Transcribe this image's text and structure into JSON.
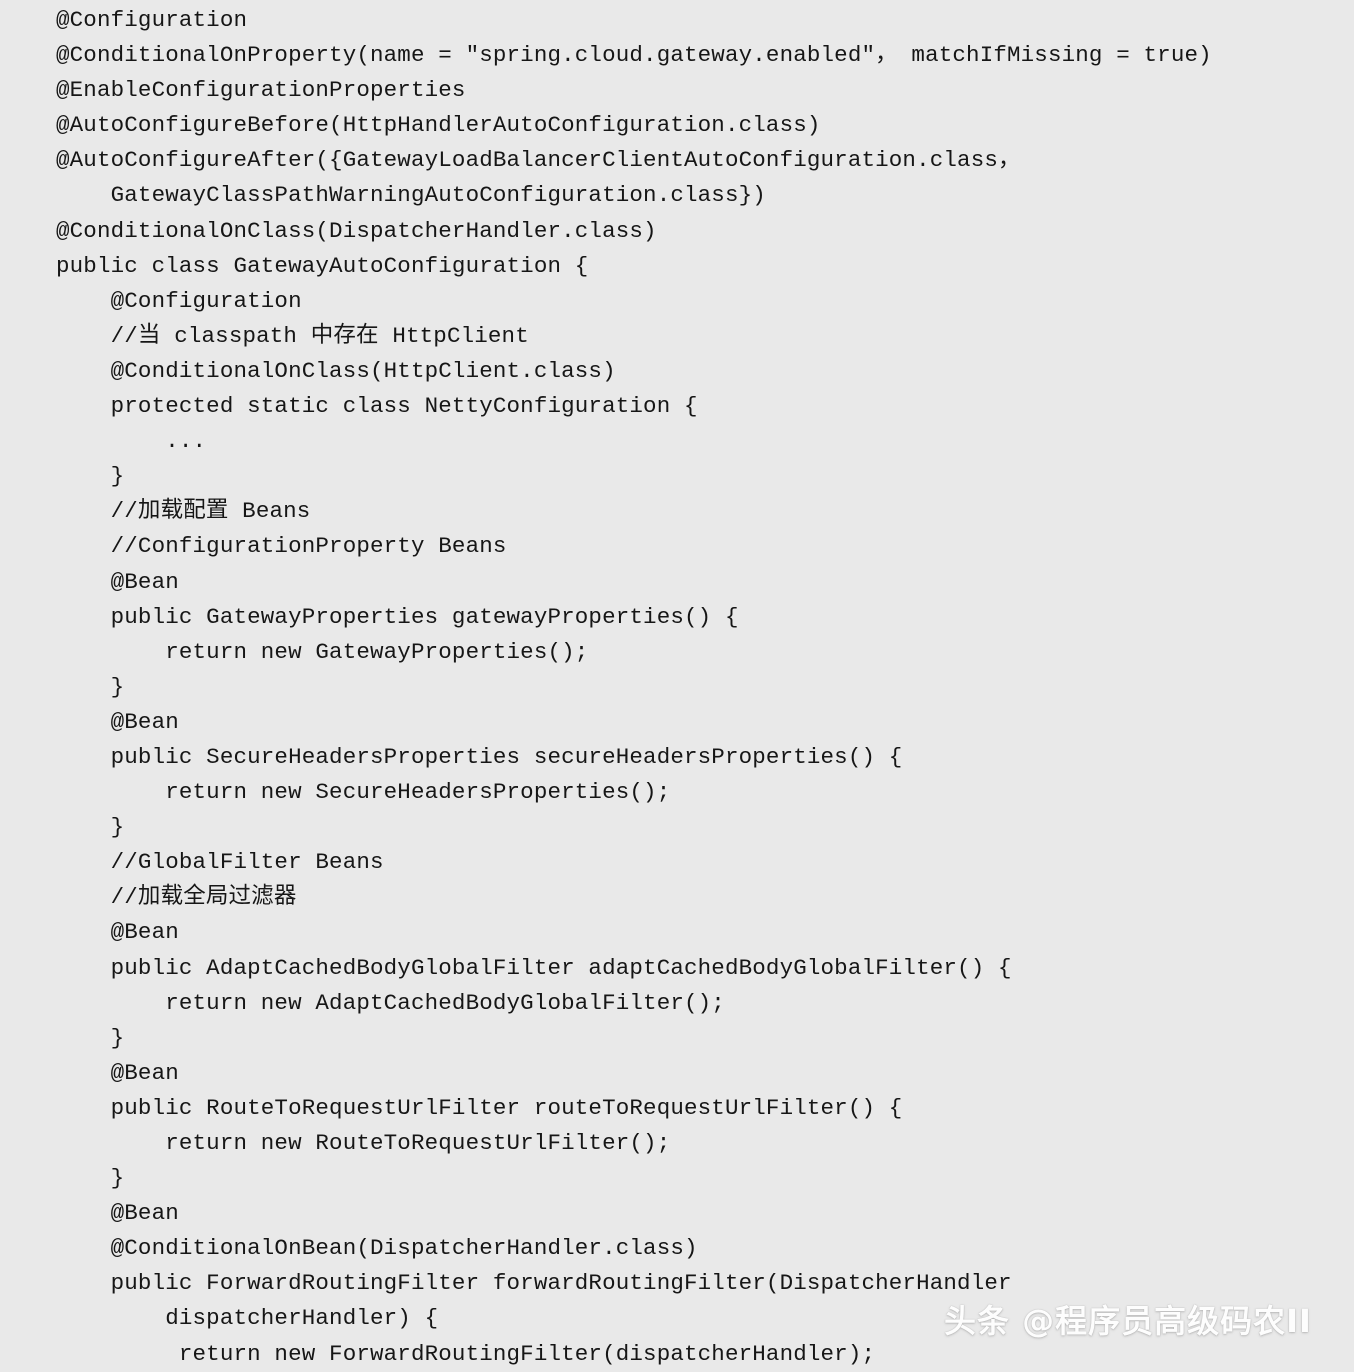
{
  "document": {
    "kind": "code-snippet",
    "language": "Java",
    "background_color": "#e9e9e9",
    "text_color": "#161616",
    "code_lines": [
      "@Configuration",
      "@ConditionalOnProperty(name = \"spring.cloud.gateway.enabled\"， matchIfMissing = true)",
      "@EnableConfigurationProperties",
      "@AutoConfigureBefore(HttpHandlerAutoConfiguration.class)",
      "@AutoConfigureAfter({GatewayLoadBalancerClientAutoConfiguration.class，",
      "    GatewayClassPathWarningAutoConfiguration.class})",
      "@ConditionalOnClass(DispatcherHandler.class)",
      "public class GatewayAutoConfiguration {",
      "    @Configuration",
      "    //当 classpath 中存在 HttpClient",
      "    @ConditionalOnClass(HttpClient.class)",
      "    protected static class NettyConfiguration {",
      "        ...",
      "    }",
      "    //加载配置 Beans",
      "    //ConfigurationProperty Beans",
      "    @Bean",
      "    public GatewayProperties gatewayProperties() {",
      "        return new GatewayProperties();",
      "    }",
      "    @Bean",
      "    public SecureHeadersProperties secureHeadersProperties() {",
      "        return new SecureHeadersProperties();",
      "    }",
      "    //GlobalFilter Beans",
      "    //加载全局过滤器",
      "    @Bean",
      "    public AdaptCachedBodyGlobalFilter adaptCachedBodyGlobalFilter() {",
      "        return new AdaptCachedBodyGlobalFilter();",
      "    }",
      "    @Bean",
      "    public RouteToRequestUrlFilter routeToRequestUrlFilter() {",
      "        return new RouteToRequestUrlFilter();",
      "    }",
      "    @Bean",
      "    @ConditionalOnBean(DispatcherHandler.class)",
      "    public ForwardRoutingFilter forwardRoutingFilter(DispatcherHandler",
      "        dispatcherHandler) {",
      "         return new ForwardRoutingFilter(dispatcherHandler);"
    ]
  },
  "watermark": {
    "text": "头条 @程序员高级码农II",
    "color": "#fdfdfd"
  }
}
